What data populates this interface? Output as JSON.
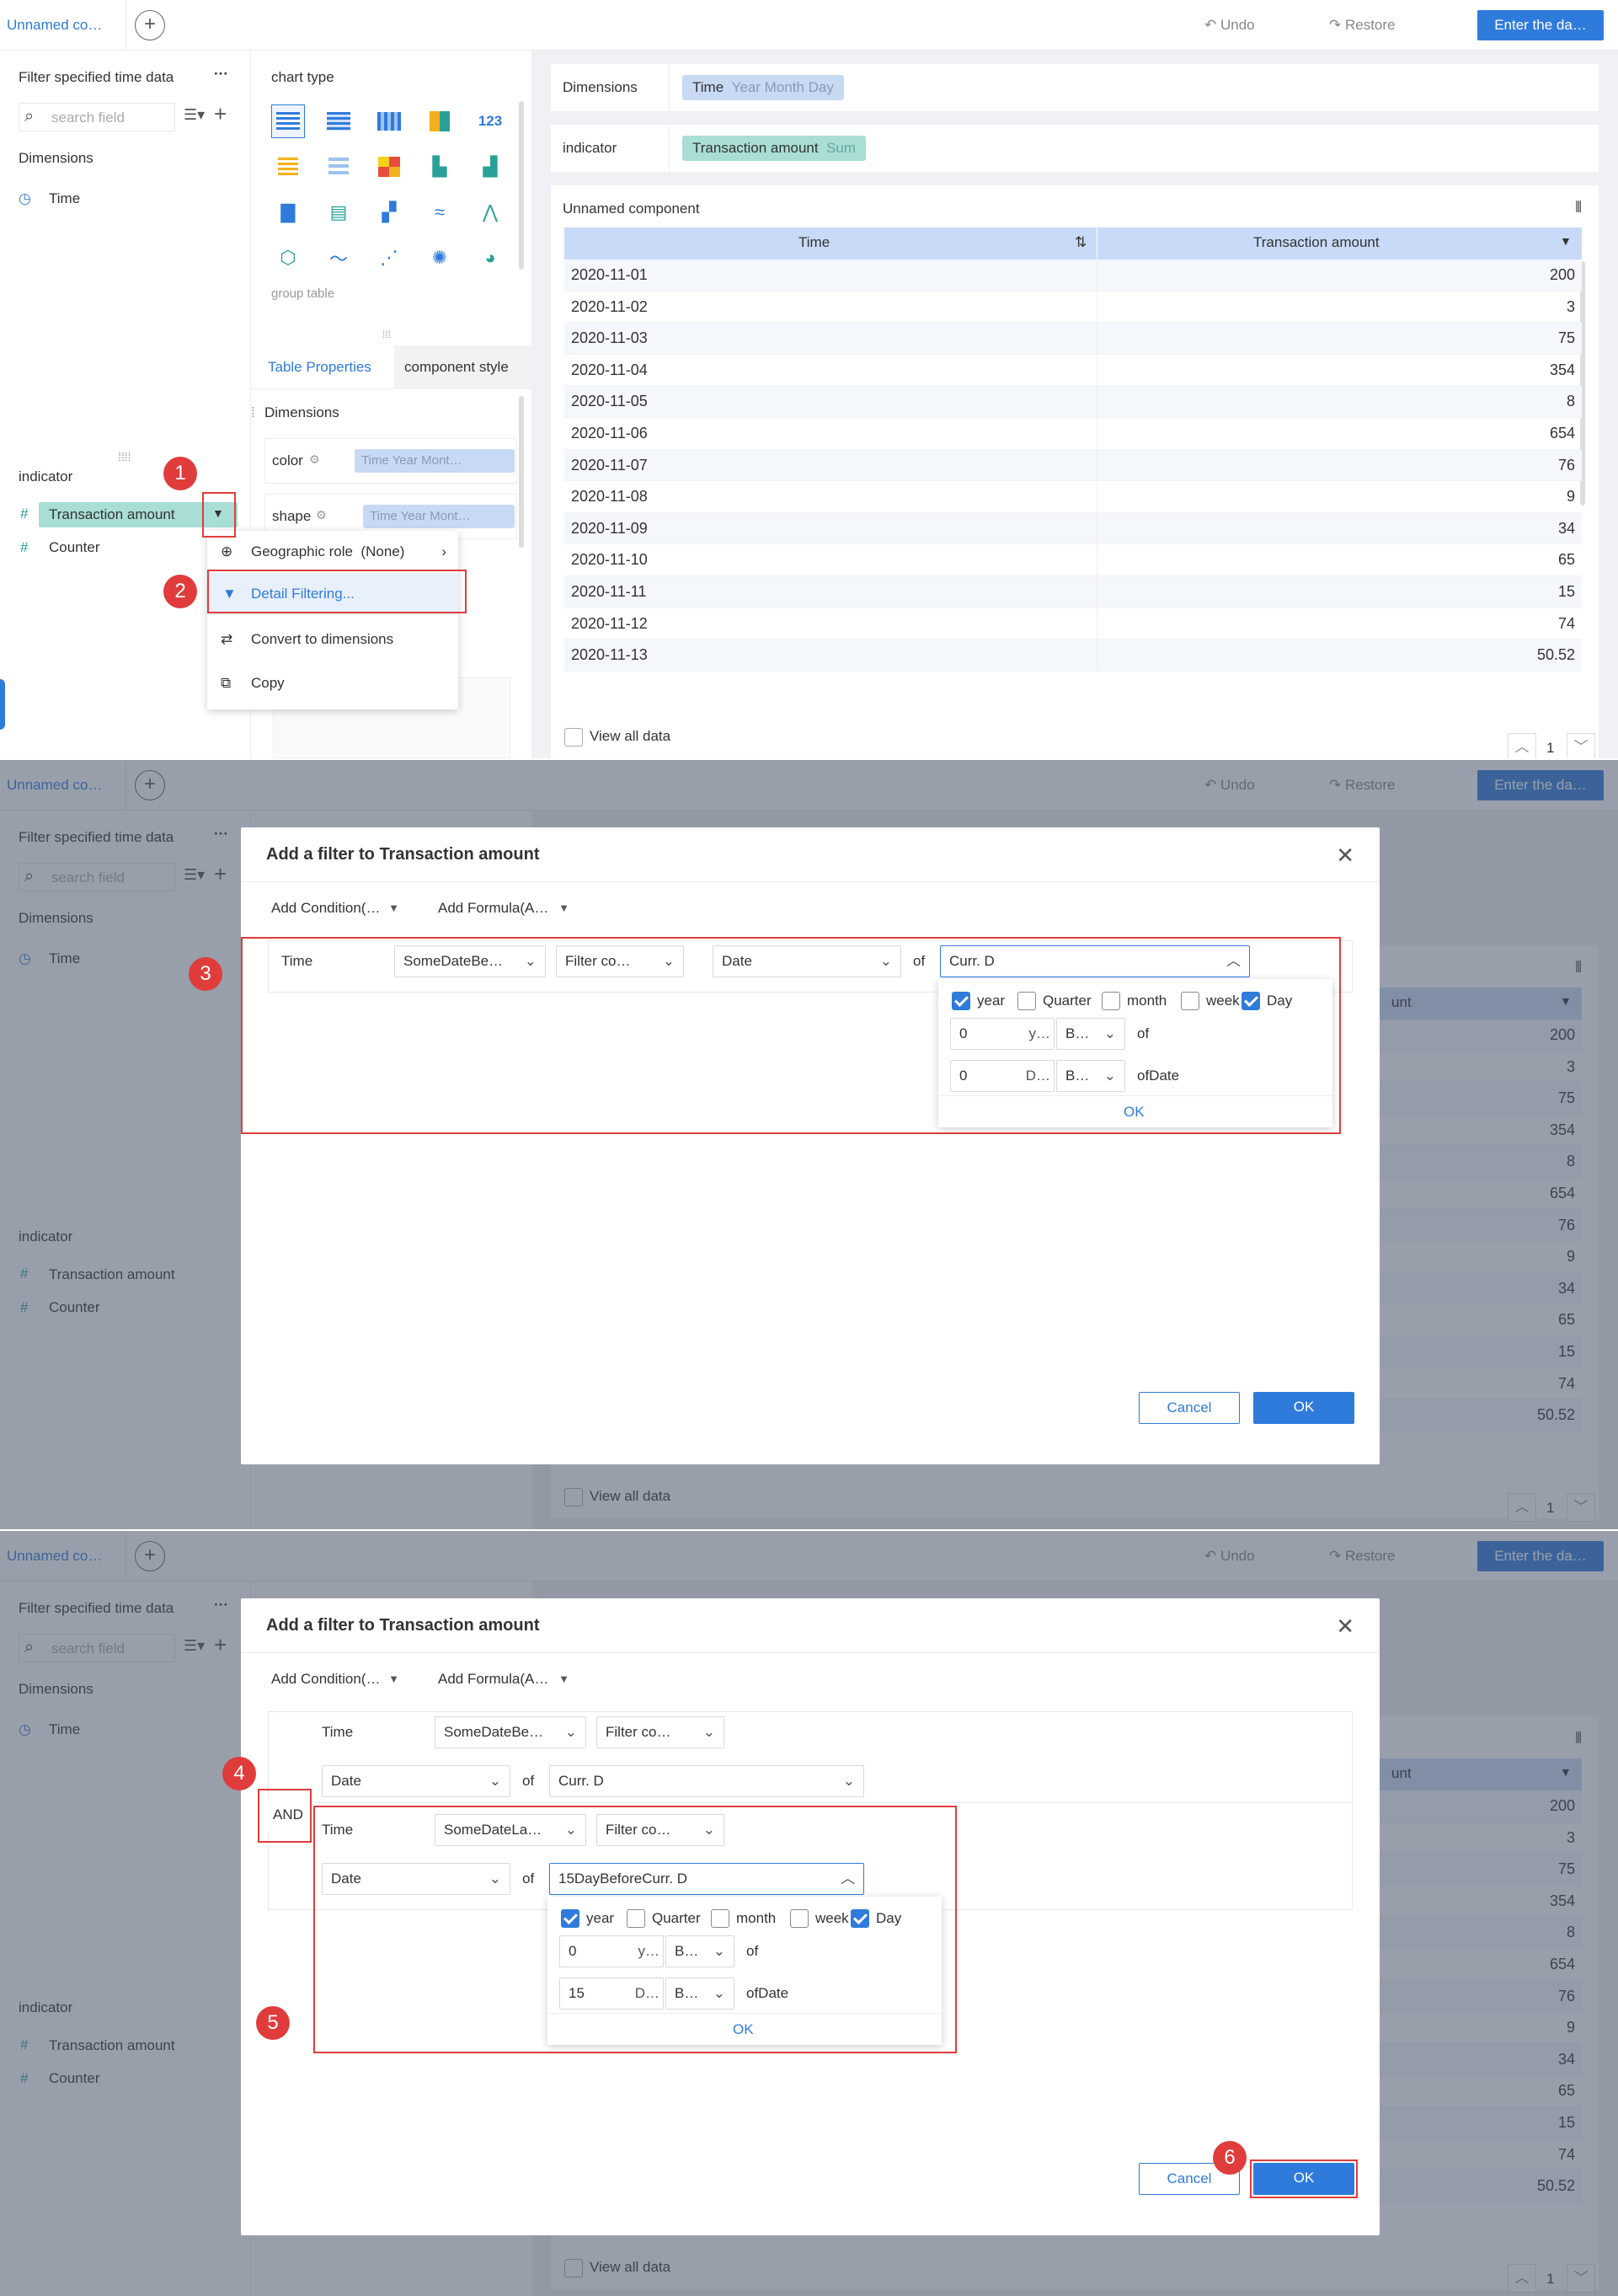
{
  "topbar": {
    "tab_label": "Unnamed co…",
    "add_tab": "+",
    "undo": "Undo",
    "restore": "Restore",
    "enter_button": "Enter the da…"
  },
  "left_panel": {
    "filter_time": "Filter specified time data",
    "more": "···",
    "search_placeholder": "search field",
    "dimensions_heading": "Dimensions",
    "dimension_time": "Time",
    "indicator_heading": "indicator",
    "indicators": [
      "Transaction amount",
      "Counter"
    ]
  },
  "middle_panel": {
    "chart_type_heading": "chart type",
    "group_table_label": "group table",
    "tab_table_properties": "Table Properties",
    "tab_component_style": "component style",
    "dimensions_heading": "Dimensions",
    "color_label": "color",
    "color_value": "Time Year Mont…",
    "shape_label": "shape",
    "shape_value": "Time Year Mont…"
  },
  "right_panel": {
    "dimensions_label": "Dimensions",
    "dimensions_tag": "Time",
    "dimensions_tag_sub": "Year Month Day",
    "indicator_label": "indicator",
    "indicator_tag": "Transaction amount",
    "indicator_tag_sub": "Sum",
    "component_title": "Unnamed component",
    "col_time": "Time",
    "col_amount": "Transaction amount",
    "rows": [
      [
        "2020-11-01",
        "200"
      ],
      [
        "2020-11-02",
        "3"
      ],
      [
        "2020-11-03",
        "75"
      ],
      [
        "2020-11-04",
        "354"
      ],
      [
        "2020-11-05",
        "8"
      ],
      [
        "2020-11-06",
        "654"
      ],
      [
        "2020-11-07",
        "76"
      ],
      [
        "2020-11-08",
        "9"
      ],
      [
        "2020-11-09",
        "34"
      ],
      [
        "2020-11-10",
        "65"
      ],
      [
        "2020-11-11",
        "15"
      ],
      [
        "2020-11-12",
        "74"
      ],
      [
        "2020-11-13",
        "50.52"
      ]
    ],
    "page": "1",
    "view_all": "View all data",
    "overlay_col_partial": "unt"
  },
  "context_menu": {
    "geographic_role": "Geographic role",
    "geographic_value": "(None)",
    "detail_filtering": "Detail Filtering...",
    "convert": "Convert to dimensions",
    "copy": "Copy"
  },
  "badges": [
    "1",
    "2",
    "3",
    "4",
    "5",
    "6"
  ],
  "dialog": {
    "title": "Add a filter to Transaction amount",
    "add_condition": "Add Condition(…",
    "add_formula": "Add Formula(A…",
    "cancel": "Cancel",
    "ok": "OK",
    "and": "AND",
    "cond1": {
      "field": "Time",
      "op": "SomeDateBe…",
      "filter": "Filter co…",
      "unit": "Date",
      "of": "of",
      "ref": "Curr. D"
    },
    "cond2": {
      "field": "Time",
      "op": "SomeDateLa…",
      "filter": "Filter co…",
      "unit": "Date",
      "of": "of",
      "ref": "15DayBeforeCurr. D"
    },
    "popup1": {
      "checks": [
        {
          "label": "year",
          "checked": true
        },
        {
          "label": "Quarter",
          "checked": false
        },
        {
          "label": "month",
          "checked": false
        },
        {
          "label": "week",
          "checked": false
        },
        {
          "label": "Day",
          "checked": true
        }
      ],
      "year_value": "0",
      "year_unit": "y…",
      "year_dir": "B…",
      "year_of": "of",
      "day_value": "0",
      "day_unit": "D…",
      "day_dir": "B…",
      "day_of": "ofDate",
      "ok": "OK"
    },
    "popup2": {
      "year_value": "0",
      "year_unit": "y…",
      "year_dir": "B…",
      "year_of": "of",
      "day_value": "15",
      "day_unit": "D…",
      "day_dir": "B…",
      "day_of": "ofDate",
      "ok": "OK"
    }
  },
  "colors": {
    "accent": "#2f7bdc",
    "highlight_red": "#e03c3c",
    "header_blue": "#c8daf7",
    "teal_tag": "#a8ded6"
  }
}
